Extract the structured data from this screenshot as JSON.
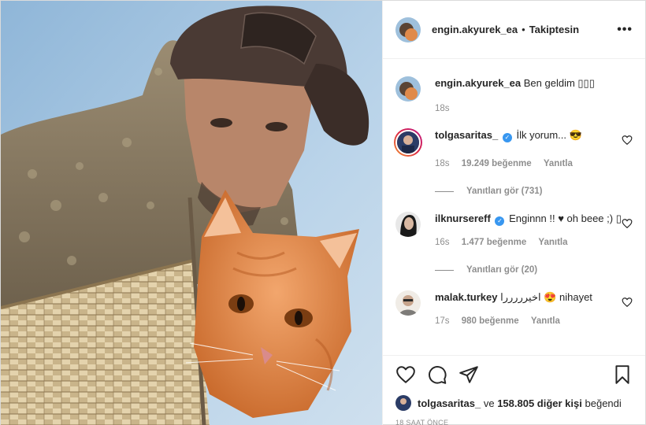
{
  "header": {
    "username": "engin.akyurek_ea",
    "separator": "•",
    "follow_status": "Takiptesin",
    "more_icon": "more-horizontal-icon"
  },
  "caption": {
    "username": "engin.akyurek_ea",
    "text": "Ben geldim ▯▯▯",
    "time": "18s"
  },
  "comments": [
    {
      "username": "tolgasaritas_",
      "verified": true,
      "text": "İlk yorum... 😎",
      "time": "18s",
      "likes": "19.249 beğenme",
      "reply": "Yanıtla",
      "view_replies": "Yanıtları gör (731)"
    },
    {
      "username": "ilknursereff",
      "verified": true,
      "text": "Enginnn !! ♥ oh beee ;) ▯",
      "time": "16s",
      "likes": "1.477 beğenme",
      "reply": "Yanıtla",
      "view_replies": "Yanıtları gör (20)"
    },
    {
      "username": "malak.turkey",
      "verified": false,
      "text": "اخيرررررا 😍 nihayet",
      "time": "17s",
      "likes": "980 beğenme",
      "reply": "Yanıtla"
    }
  ],
  "actions": {
    "like_icon": "heart-icon",
    "comment_icon": "comment-icon",
    "share_icon": "send-icon",
    "save_icon": "bookmark-icon"
  },
  "liked_by": {
    "user": "tolgasaritas_",
    "connector": "ve",
    "others": "158.805 diğer kişi",
    "suffix": "beğendi"
  },
  "timestamp": "18 SAAT ÖNCE",
  "colors": {
    "sky": "#a9cbe6",
    "cat": "#e8894a",
    "hood": "#8a7a62",
    "cap": "#4a3a34",
    "verified": "#3897f0"
  }
}
